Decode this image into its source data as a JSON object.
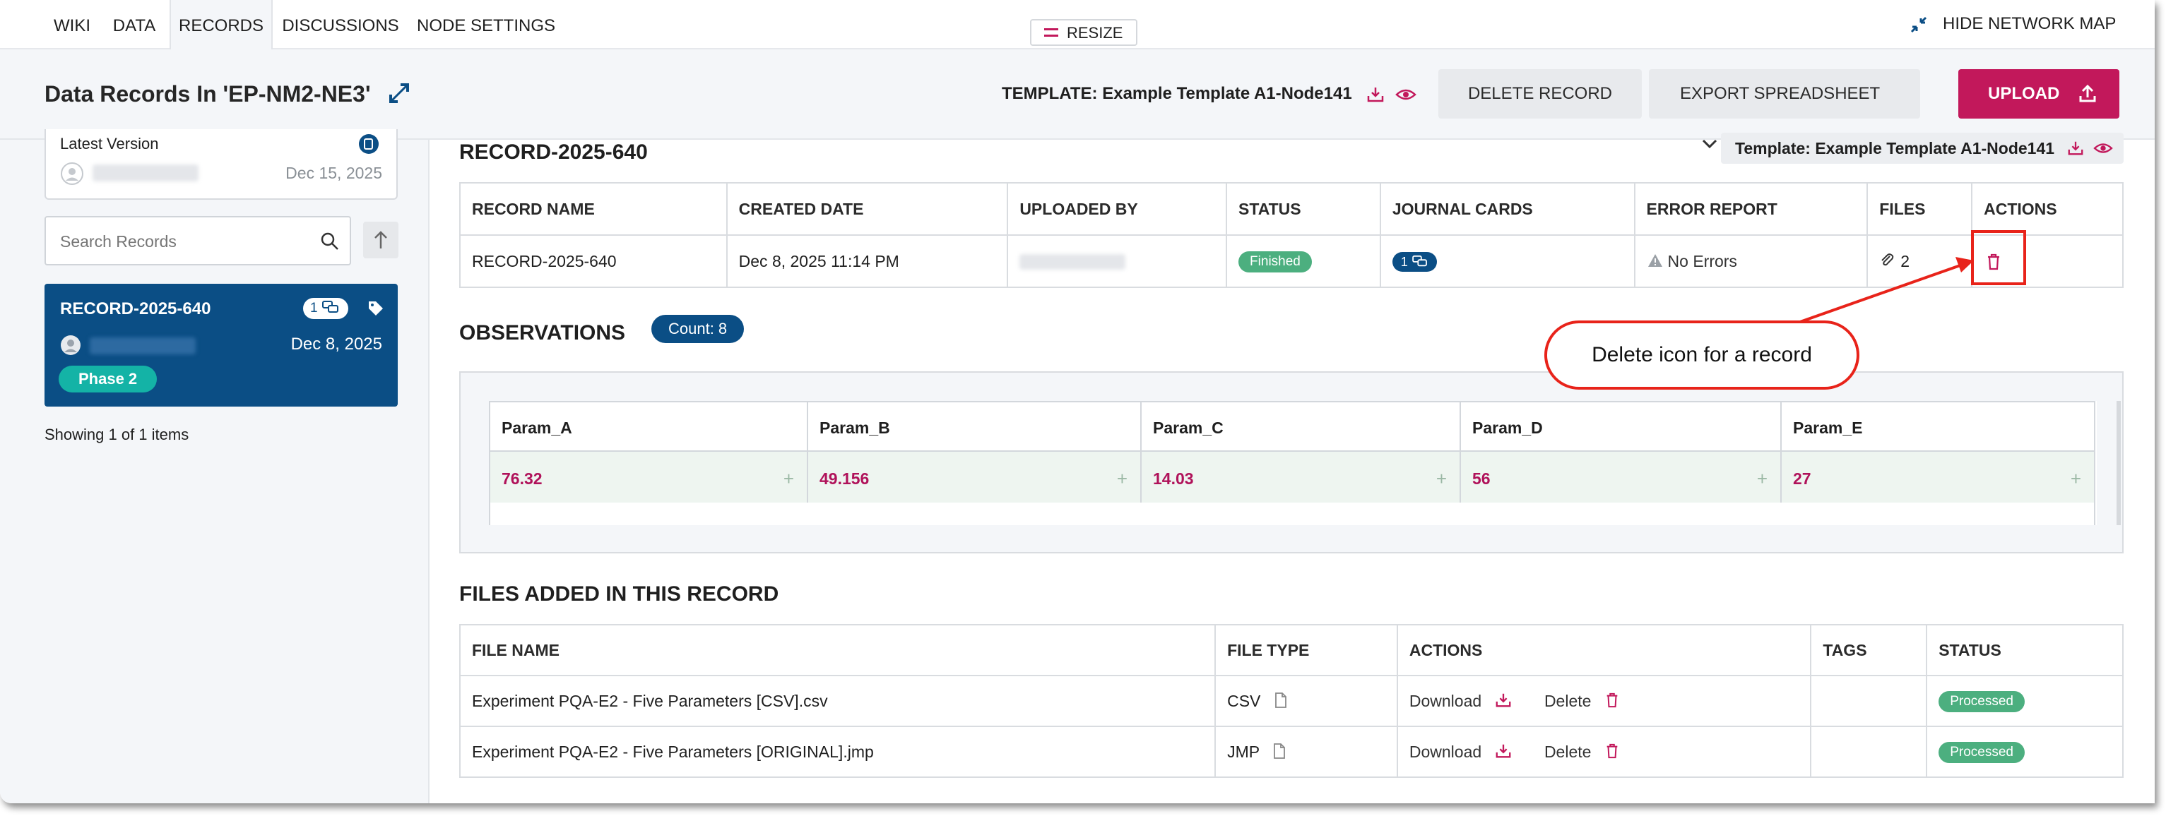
{
  "nav": {
    "tabs": [
      {
        "label": "WIKI"
      },
      {
        "label": "DATA"
      },
      {
        "label": "RECORDS"
      },
      {
        "label": "DISCUSSIONS"
      },
      {
        "label": "NODE SETTINGS"
      }
    ],
    "active_tab": "RECORDS",
    "resize_label": "RESIZE",
    "hide_map_label": "HIDE NETWORK MAP"
  },
  "header": {
    "title": "Data Records In 'EP-NM2-NE3'",
    "template_label": "TEMPLATE: Example Template A1-Node141",
    "delete_record_label": "DELETE RECORD",
    "export_label": "EXPORT SPREADSHEET",
    "upload_label": "UPLOAD"
  },
  "sidebar": {
    "version_label": "Latest Version",
    "version_date": "Dec 15, 2025",
    "search_placeholder": "Search Records",
    "record_card": {
      "name": "RECORD-2025-640",
      "journal_count": "1",
      "date": "Dec 8, 2025",
      "phase": "Phase 2"
    },
    "showing_text": "Showing 1 of 1 items"
  },
  "record": {
    "title": "RECORD-2025-640",
    "template_tag": "Template: Example Template A1-Node141",
    "columns": [
      "RECORD NAME",
      "CREATED DATE",
      "UPLOADED BY",
      "STATUS",
      "JOURNAL CARDS",
      "ERROR REPORT",
      "FILES",
      "ACTIONS"
    ],
    "row": {
      "name": "RECORD-2025-640",
      "created": "Dec 8, 2025 11:14 PM",
      "status": "Finished",
      "journal": "1",
      "errors": "No Errors",
      "files": "2"
    }
  },
  "observations": {
    "title": "OBSERVATIONS",
    "count_label": "Count: 8",
    "params": [
      {
        "name": "Param_A",
        "value": "76.32"
      },
      {
        "name": "Param_B",
        "value": "49.156"
      },
      {
        "name": "Param_C",
        "value": "14.03"
      },
      {
        "name": "Param_D",
        "value": "56"
      },
      {
        "name": "Param_E",
        "value": "27"
      }
    ]
  },
  "files": {
    "title": "FILES ADDED IN THIS RECORD",
    "columns": [
      "FILE NAME",
      "FILE TYPE",
      "ACTIONS",
      "TAGS",
      "STATUS"
    ],
    "download_label": "Download",
    "delete_label": "Delete",
    "rows": [
      {
        "name": "Experiment PQA-E2 - Five Parameters [CSV].csv",
        "type": "CSV",
        "status": "Processed"
      },
      {
        "name": "Experiment PQA-E2 - Five Parameters [ORIGINAL].jmp",
        "type": "JMP",
        "status": "Processed"
      }
    ]
  },
  "annotation": {
    "callout_text": "Delete icon for a record"
  },
  "colors": {
    "accent": "#c2185b",
    "navy": "#0b4e85",
    "success": "#4caf7f",
    "annotation_red": "#e8231a"
  }
}
